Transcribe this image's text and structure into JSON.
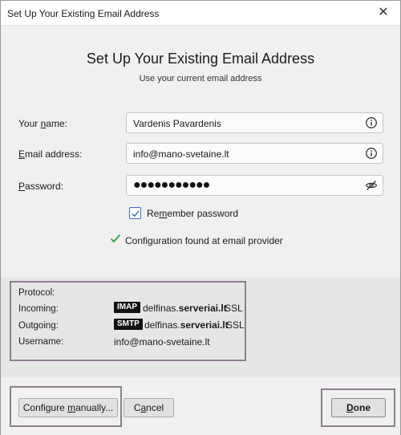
{
  "window": {
    "title": "Set Up Your Existing Email Address",
    "close_glyph": "✕"
  },
  "header": {
    "title": "Set Up Your Existing Email Address",
    "subtitle": "Use your current email address"
  },
  "form": {
    "name": {
      "label_pre": "Your ",
      "label_key": "n",
      "label_post": "ame:",
      "value": "Vardenis Pavardenis",
      "icon": "info-icon"
    },
    "email": {
      "label_pre": "",
      "label_key": "E",
      "label_post": "mail address:",
      "value": "info@mano-svetaine.lt",
      "icon": "info-icon"
    },
    "password": {
      "label_pre": "",
      "label_key": "P",
      "label_post": "assword:",
      "value": "●●●●●●●●●●●",
      "icon": "eye-slash-icon"
    },
    "remember": {
      "label_pre": "Re",
      "label_key": "m",
      "label_post": "ember password",
      "checked": true
    }
  },
  "status": {
    "text": "Configuration found at email provider",
    "icon": "check-icon",
    "color": "#2aa745"
  },
  "protocol": {
    "protocol_label": "Protocol:",
    "incoming_label": "Incoming:",
    "outgoing_label": "Outgoing:",
    "username_label": "Username:",
    "incoming_badge": "IMAP",
    "outgoing_badge": "SMTP",
    "incoming_host_pre": "delfinas.",
    "incoming_host_bold": "serveriai.lt",
    "outgoing_host_pre": "delfinas.",
    "outgoing_host_bold": "serveriai.lt",
    "incoming_security": "SSL",
    "outgoing_security": "SSL",
    "username_value": "info@mano-svetaine.lt"
  },
  "footer": {
    "configure_pre": "Configure ",
    "configure_key": "m",
    "configure_post": "anually...",
    "cancel_pre": "C",
    "cancel_key": "a",
    "cancel_post": "ncel",
    "done_pre": "",
    "done_key": "D",
    "done_post": "one"
  },
  "colors": {
    "highlight_border": "#8c7f8e",
    "checkbox_accent": "#3b6fc4"
  }
}
